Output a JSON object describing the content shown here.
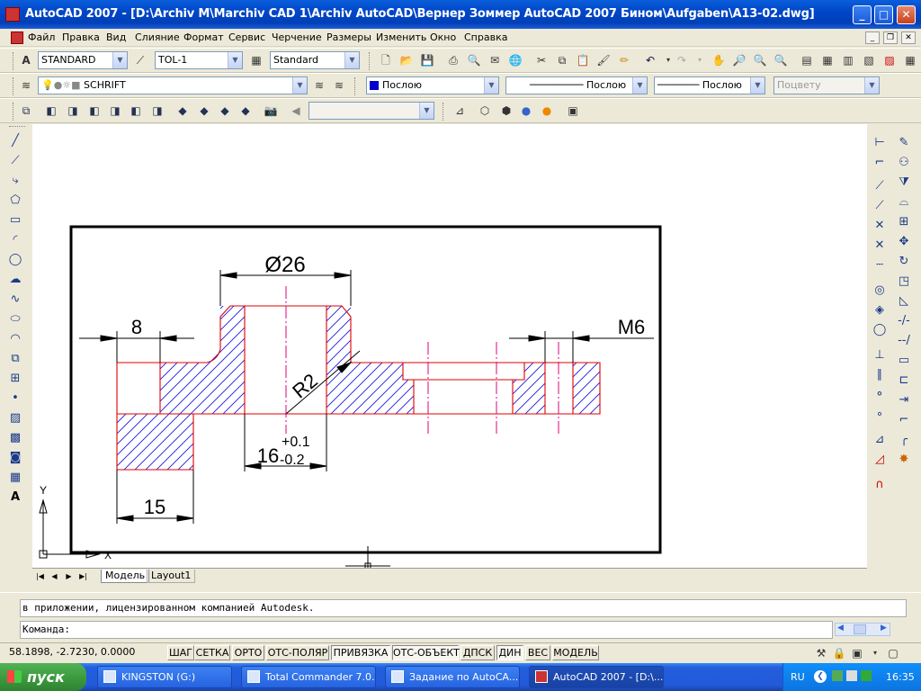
{
  "window": {
    "title": "AutoCAD 2007 - [D:\\Archiv M\\Marchiv CAD 1\\Archiv AutoCAD\\Вернер Зоммер AutoCAD 2007 Бином\\Aufgaben\\A13-02.dwg]",
    "min": "_",
    "max": "□",
    "close": "✕"
  },
  "menu": [
    "Файл",
    "Правка",
    "Вид",
    "Слияние",
    "Формат",
    "Сервис",
    "Черчение",
    "Размеры",
    "Изменить",
    "Окно",
    "Справка"
  ],
  "toolbar": {
    "text_style": "STANDARD",
    "dim_style": "TOL-1",
    "table_style": "Standard",
    "layer": "SCHRIFT",
    "color": "Послою",
    "linetype": "Послою",
    "lineweight": "Послою",
    "plot_style": "Поцвету"
  },
  "drawing": {
    "dim_diameter": "Ø26",
    "dim_8": "8",
    "dim_m6": "M6",
    "dim_r2": "R2",
    "dim_16": "16",
    "tol_upper": "+0.1",
    "tol_lower": "-0.2",
    "dim_15": "15",
    "ucs_y": "Y",
    "ucs_x": "X"
  },
  "tabs": {
    "model": "Модель",
    "layout1": "Layout1"
  },
  "command": {
    "history": "в приложении, лицензированном компанией Autodesk.",
    "prompt": "Команда:"
  },
  "status": {
    "coords": "58.1898, -2.7230, 0.0000",
    "buttons": [
      "ШАГ",
      "СЕТКА",
      "ОРТО",
      "ОТС-ПОЛЯР",
      "ПРИВЯЗКА",
      "ОТС-ОБЪЕКТ",
      "ДПСК",
      "ДИН",
      "ВЕС",
      "МОДЕЛЬ"
    ]
  },
  "taskbar": {
    "start": "пуск",
    "tasks": [
      "KINGSTON (G:)",
      "Total Commander 7.0...",
      "Задание по AutoCA...",
      "AutoCAD 2007 - [D:\\..."
    ],
    "lang": "RU",
    "clock": "16:35"
  },
  "colors": {
    "title_blue": "#0A5EDB",
    "hatch_blue": "#1A1AE0",
    "part_red": "#E00000",
    "centerline": "#E00080"
  }
}
